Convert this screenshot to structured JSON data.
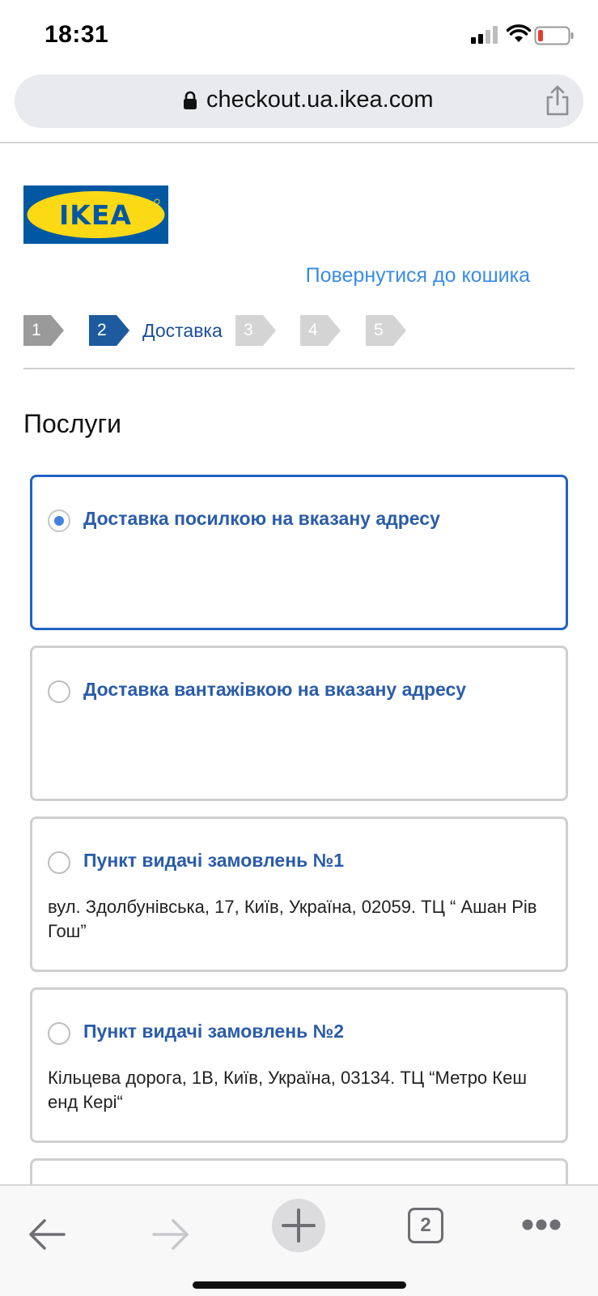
{
  "status_bar": {
    "time": "18:31"
  },
  "browser": {
    "url": "checkout.ua.ikea.com",
    "tab_count": "2"
  },
  "brand": {
    "logo_text": "IKEA",
    "logo_blue": "#0058a3",
    "logo_yellow": "#fbd914"
  },
  "header": {
    "back_to_cart": "Повернутися до кошика"
  },
  "stepper": {
    "steps": [
      {
        "number": "1",
        "label": "",
        "state": "done"
      },
      {
        "number": "2",
        "label": "Доставка",
        "state": "current"
      },
      {
        "number": "3",
        "label": "",
        "state": "upcoming"
      },
      {
        "number": "4",
        "label": "",
        "state": "upcoming"
      },
      {
        "number": "5",
        "label": "",
        "state": "upcoming"
      }
    ]
  },
  "services": {
    "title": "Послуги",
    "options": [
      {
        "title": "Доставка посилкою на вказану адресу",
        "address": "",
        "selected": true
      },
      {
        "title": "Доставка вантажівкою на вказану адресу",
        "address": "",
        "selected": false
      },
      {
        "title": "Пункт видачі замовлень №1",
        "address": "вул. Здолбунівська, 17, Київ, Україна, 02059. ТЦ “ Ашан Рів Гош”",
        "selected": false
      },
      {
        "title": "Пункт видачі замовлень №2",
        "address": "Кільцева дорога, 1В, Київ, Україна, 03134. ТЦ “Метро Кеш енд Кері“",
        "selected": false
      }
    ]
  },
  "colors": {
    "accent_blue": "#1f63c2",
    "link_blue": "#3a8be6",
    "step_done": "#9a9a9a",
    "step_current": "#1d5a9e",
    "step_upcoming": "#d4d4d4"
  }
}
